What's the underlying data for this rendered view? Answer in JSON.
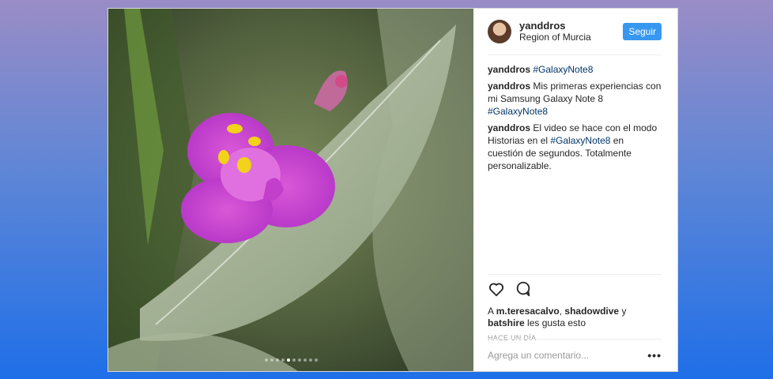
{
  "post": {
    "username": "yanddros",
    "location": "Region of Murcia",
    "follow_label": "Seguir",
    "carousel": {
      "dot_count": 10,
      "active_index": 4
    }
  },
  "comments": [
    {
      "user": "yanddros",
      "pre": "",
      "tag": "#GalaxyNote8",
      "post": ""
    },
    {
      "user": "yanddros",
      "pre": " Mis primeras experiencias con mi Samsung Galaxy Note 8 ",
      "tag": "#GalaxyNote8",
      "post": ""
    },
    {
      "user": "yanddros",
      "pre": " El video se hace con el modo Historias en el ",
      "tag": "#GalaxyNote8",
      "post": " en cuestión de segundos. Totalmente personalizable."
    }
  ],
  "likes": {
    "prefix": "A ",
    "user1": "m.teresacalvo",
    "sep1": ", ",
    "user2": "shadowdive",
    "sep2": " y ",
    "user3": "batshire",
    "suffix": " les gusta esto"
  },
  "time_label": "HACE UN DÍA",
  "comment_placeholder": "Agrega un comentario...",
  "more_label": "•••",
  "icons": {
    "like": "heart-icon",
    "comment": "comment-icon"
  }
}
